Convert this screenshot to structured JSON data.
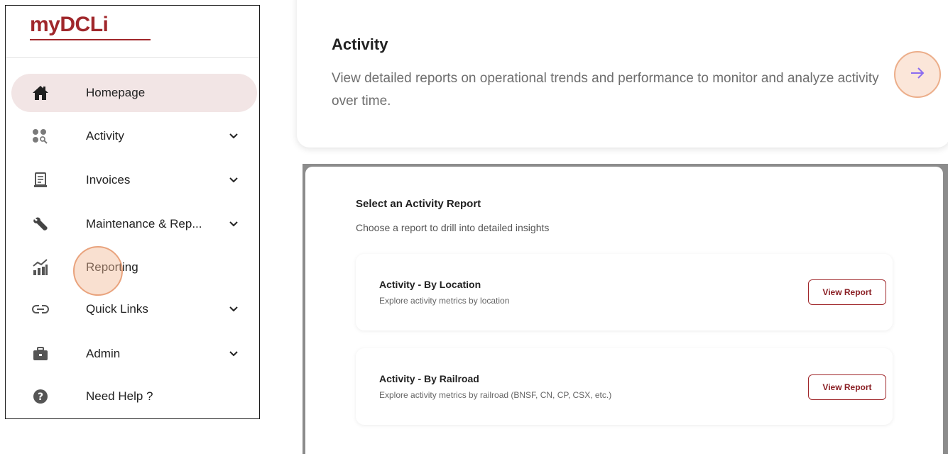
{
  "brand": {
    "logo_text": "myDCLi",
    "color": "#a0272b"
  },
  "sidebar": {
    "items": [
      {
        "label": "Homepage",
        "icon": "home-icon",
        "active": true,
        "has_chevron": false
      },
      {
        "label": "Activity",
        "icon": "activity-dots-search-icon",
        "active": false,
        "has_chevron": true
      },
      {
        "label": "Invoices",
        "icon": "invoice-icon",
        "active": false,
        "has_chevron": true
      },
      {
        "label": "Maintenance & Rep...",
        "icon": "wrench-icon",
        "active": false,
        "has_chevron": true
      },
      {
        "label": "Reporting",
        "icon": "reporting-chart-icon",
        "active": false,
        "has_chevron": false
      },
      {
        "label": "Quick Links",
        "icon": "link-icon",
        "active": false,
        "has_chevron": true
      },
      {
        "label": "Admin",
        "icon": "briefcase-icon",
        "active": false,
        "has_chevron": true
      },
      {
        "label": "Need Help ?",
        "icon": "help-icon",
        "active": false,
        "has_chevron": false
      }
    ]
  },
  "activity_card": {
    "title": "Activity",
    "description": "View detailed reports on operational trends and performance to monitor and analyze activity over time.",
    "action_icon": "arrow-right-icon"
  },
  "report_panel": {
    "title": "Select an Activity Report",
    "subtitle": "Choose a report to drill into detailed insights",
    "reports": [
      {
        "title": "Activity - By Location",
        "description": "Explore activity metrics by location",
        "button_label": "View Report"
      },
      {
        "title": "Activity - By Railroad",
        "description": "Explore activity metrics by railroad (BNSF, CN, CP, CSX, etc.)",
        "button_label": "View Report"
      }
    ]
  },
  "colors": {
    "accent": "#a0272b",
    "active_nav_bg": "#f2e5e5",
    "highlight_ring": "#e9a37d",
    "arrow_icon": "#8b6cf0"
  }
}
